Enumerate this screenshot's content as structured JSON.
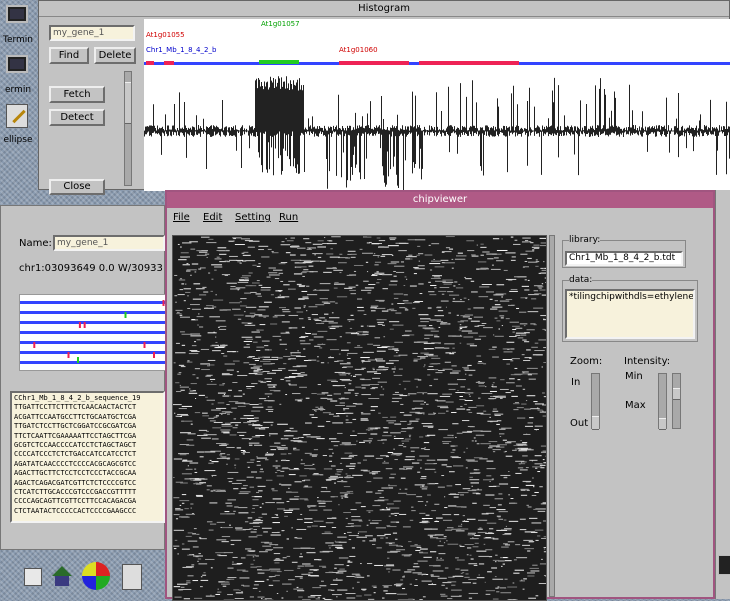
{
  "desktop_icons": [
    {
      "label": "Termin",
      "icon": "terminal-icon"
    },
    {
      "label": "ermin",
      "icon": "terminal-icon"
    },
    {
      "label": "ellipse",
      "icon": "pencil-icon"
    }
  ],
  "histogram_window": {
    "title": "Histogram",
    "gene_field": "my_gene_1",
    "buttons": {
      "find": "Find",
      "delete": "Delete",
      "fetch": "Fetch",
      "detect": "Detect",
      "close": "Close"
    },
    "annotations": {
      "green_top": "At1g01057",
      "red_left": "At1g01055",
      "blue_left": "Chr1_Mb_1_8_4_2_b",
      "red_right": "At1g01060"
    }
  },
  "gene_window": {
    "name_label": "Name:",
    "name_value": "my_gene_1",
    "position": "chr1:03093649 0.0 W/30933",
    "sequence_lines": [
      "CChr1_Mb_1_8_4_2_b_sequence_19",
      "TTGATTCCTTCTTTCTCAACAACTACTCT",
      "ACGATTCCAATGCCTTCTGCAATGCTCGA",
      "TTGATCTCCTTGCTCGGATCCGCGATCGA",
      "TTCTCAATTCGAAAAATTCCTAGCTTCGA",
      "GCGTCTCCAACCCCATCCTCTAGCTAGCT",
      "CCCCATCCCTCTCTGACCATCCATCCTCT",
      "AGATATCAACCCCTCCCCACGCAGCGTCC",
      "AGACTTGCTTCTCCTCCTCCCTACCGCAA",
      "AGACTCAGACGATCGTTCTCTCCCCGTCC",
      "CTCATCTTGCACCCGTCCCGACCGTTTTT",
      "CCCCAGCAGTTCGTTCCTTCCACAGACGA",
      "CTCTAATACTCCCCCACTCCCCGAAGCCC"
    ]
  },
  "chip_window": {
    "title": "chipviewer",
    "menu": [
      "File",
      "Edit",
      "Setting",
      "Run"
    ],
    "library_label": "library:",
    "library_value": "Chr1_Mb_1_8_4_2_b.tdt",
    "data_label": "data:",
    "data_value": "*tilingchipwithdls=ethylene",
    "zoom_label": "Zoom:",
    "zoom_in": "In",
    "zoom_out": "Out",
    "intensity_label": "Intensity:",
    "intensity_min": "Min",
    "intensity_max": "Max"
  },
  "dock_icons": [
    "file-manager-icon",
    "home-icon",
    "globe-icon",
    "clock-icon"
  ]
}
